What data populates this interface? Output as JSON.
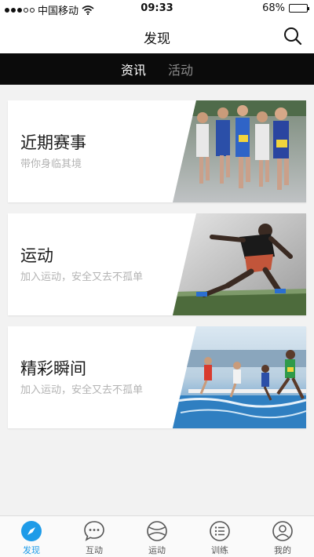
{
  "status": {
    "carrier": "中国移动",
    "time": "09:33",
    "battery": "68%",
    "battery_level": 0.68
  },
  "header": {
    "title": "发现"
  },
  "tabs": [
    {
      "label": "资讯",
      "active": true
    },
    {
      "label": "活动",
      "active": false
    }
  ],
  "cards": [
    {
      "title": "近期赛事",
      "subtitle": "带你身临其境",
      "image": "marathon-runners"
    },
    {
      "title": "运动",
      "subtitle": "加入运动，安全又去不孤单",
      "image": "sprinter"
    },
    {
      "title": "精彩瞬间",
      "subtitle": "加入运动，安全又去不孤单",
      "image": "steeplechase"
    }
  ],
  "bottom_nav": [
    {
      "label": "发现",
      "icon": "compass-icon",
      "active": true
    },
    {
      "label": "互动",
      "icon": "chat-bubble-icon",
      "active": false
    },
    {
      "label": "运动",
      "icon": "ball-icon",
      "active": false
    },
    {
      "label": "训练",
      "icon": "list-icon",
      "active": false
    },
    {
      "label": "我的",
      "icon": "user-icon",
      "active": false
    }
  ],
  "colors": {
    "accent": "#1e9be8",
    "tab_bg": "#0b0b0b"
  }
}
